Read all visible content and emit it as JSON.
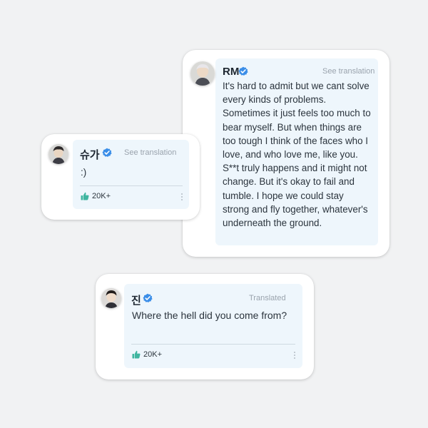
{
  "posts": [
    {
      "id": "rm",
      "name": "RM",
      "action": "See translation",
      "text": "It's hard to admit but we cant solve every kinds of problems. Sometimes it just feels too much to bear myself. But when things are too tough I think of the faces who I love, and who love me, like you. S**t truly happens and it might not change. But it's okay to fail and tumble. I hope we could stay strong and fly together, whatever's underneath the ground."
    },
    {
      "id": "suga",
      "name": "슈가",
      "action": "See translation",
      "text": ":)",
      "likes": "20K+"
    },
    {
      "id": "jin",
      "name": "진",
      "action": "Translated",
      "text": "Where the hell did you come from?",
      "likes": "20K+"
    }
  ],
  "colors": {
    "card_bg": "#eef6fc",
    "verified_blue": "#3b8ee8",
    "like_green": "#3fb5a0"
  }
}
